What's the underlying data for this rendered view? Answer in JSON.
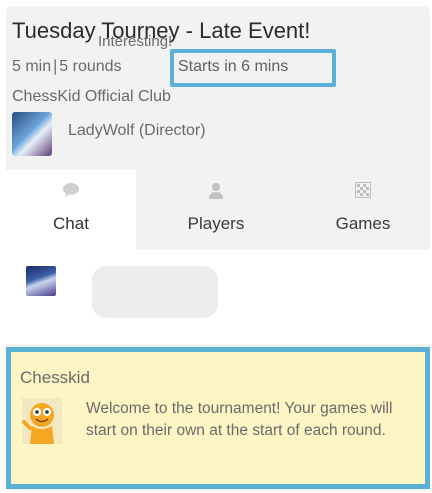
{
  "header": {
    "title": "Tuesday Tourney - Late Event!",
    "duration": "5 min",
    "separator": "|",
    "rounds": "5 rounds",
    "starts": "Starts in 6 mins",
    "club": "ChessKid Official Club",
    "director": "LadyWolf (Director)"
  },
  "tabs": [
    {
      "label": "Chat",
      "icon": "chat-bubble-icon",
      "active": true
    },
    {
      "label": "Players",
      "icon": "person-icon",
      "active": false
    },
    {
      "label": "Games",
      "icon": "grid-board-icon",
      "active": false
    }
  ],
  "chat": {
    "message": "Interesting!"
  },
  "notice": {
    "title": "Chesskid",
    "body": "Welcome to the tournament! Your games will start on their own at the start of each round.",
    "avatar_icon": "chesskid-mascot-icon"
  },
  "colors": {
    "highlight_border": "#5bb0d6",
    "notice_background": "#fdf6c4",
    "header_background": "#f2f2f2"
  }
}
